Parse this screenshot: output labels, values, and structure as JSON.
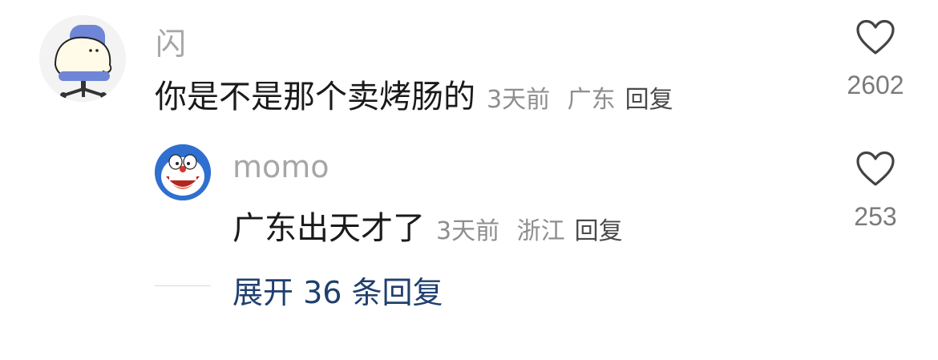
{
  "comment": {
    "author": "闪",
    "text": "你是不是那个卖烤肠的",
    "time": "3天前",
    "location": "广东",
    "reply_label": "回复",
    "likes": "2602",
    "avatar_icon": "chair-ghost-avatar"
  },
  "reply_comment": {
    "author": "momo",
    "text": "广东出天才了",
    "time": "3天前",
    "location": "浙江",
    "reply_label": "回复",
    "likes": "253",
    "avatar_icon": "doraemon-avatar"
  },
  "expand": {
    "label": "展开 36 条回复"
  },
  "colors": {
    "expand_text": "#1f3f6e",
    "author_text": "#a6a6a6",
    "meta_text": "#8e8e8e"
  }
}
